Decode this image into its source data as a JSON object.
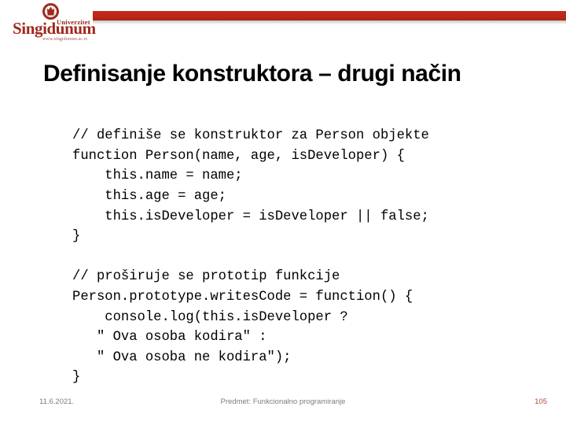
{
  "theme": {
    "accent_red": "#bc2718",
    "logo_red": "#9e2a1e",
    "footer_gray": "#7c7c7c",
    "page_number_color": "#b04a3a",
    "background": "#ffffff"
  },
  "logo": {
    "emblem_name": "singidunum-crest",
    "line_small": "Univerzitet",
    "wordmark": "Singidunum",
    "url": "www.singidunum.ac.rs"
  },
  "title": "Definisanje konstruktora – drugi način",
  "code": {
    "text": "// definiše se konstruktor za Person objekte\nfunction Person(name, age, isDeveloper) {\n    this.name = name;\n    this.age = age;\n    this.isDeveloper = isDeveloper || false;\n}\n\n// proširuje se prototip funkcije\nPerson.prototype.writesCode = function() {\n    console.log(this.isDeveloper ?\n   \" Ova osoba kodira\" :\n   \" Ova osoba ne kodira\");\n}",
    "lines": [
      "// definiše se konstruktor za Person objekte",
      "function Person(name, age, isDeveloper) {",
      "    this.name = name;",
      "    this.age = age;",
      "    this.isDeveloper = isDeveloper || false;",
      "}",
      "",
      "// proširuje se prototip funkcije",
      "Person.prototype.writesCode = function() {",
      "    console.log(this.isDeveloper ?",
      "   \" Ova osoba kodira\" :",
      "   \" Ova osoba ne kodira\");",
      "}"
    ]
  },
  "footer": {
    "date": "11.6.2021.",
    "subject": "Predmet: Funkcionalno programiranje",
    "page_number": "105"
  }
}
